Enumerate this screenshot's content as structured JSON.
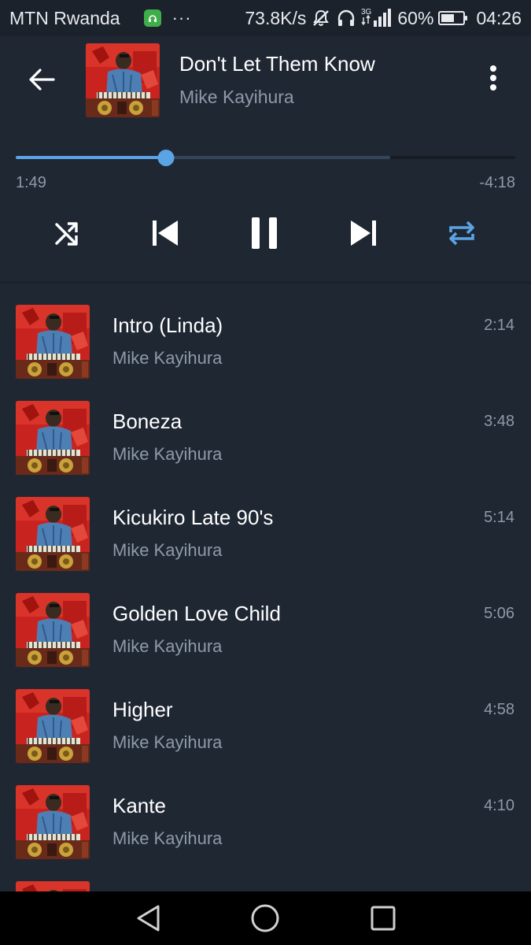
{
  "status_bar": {
    "carrier": "MTN Rwanda",
    "more": "···",
    "net_speed": "73.8K/s",
    "network_type": "3G",
    "battery": "60%",
    "battery_level": 0.6,
    "time": "04:26",
    "icons": [
      "app-notification-icon",
      "mute-icon",
      "headphones-icon",
      "signal-icon",
      "battery-icon"
    ]
  },
  "now_playing": {
    "title": "Don't Let Them Know",
    "artist": "Mike Kayihura",
    "elapsed": "1:49",
    "remaining": "-4:18",
    "progress": 0.3,
    "buffered": 0.75,
    "state": "playing"
  },
  "controls": {
    "icons": [
      "shuffle-icon",
      "previous-icon",
      "pause-icon",
      "next-icon",
      "repeat-icon"
    ],
    "repeat_active": true
  },
  "tracks": [
    {
      "title": "Intro (Linda)",
      "artist": "Mike Kayihura",
      "duration": "2:14"
    },
    {
      "title": "Boneza",
      "artist": "Mike Kayihura",
      "duration": "3:48"
    },
    {
      "title": "Kicukiro Late 90's",
      "artist": "Mike Kayihura",
      "duration": "5:14"
    },
    {
      "title": "Golden Love Child",
      "artist": "Mike Kayihura",
      "duration": "5:06"
    },
    {
      "title": "Higher",
      "artist": "Mike Kayihura",
      "duration": "4:58"
    },
    {
      "title": "Kante",
      "artist": "Mike Kayihura",
      "duration": "4:10"
    },
    {
      "title": "",
      "artist": "",
      "duration": ""
    }
  ],
  "colors": {
    "background": "#1f2733",
    "accent": "#5aa3e5",
    "secondary_text": "#8e9aa8"
  }
}
